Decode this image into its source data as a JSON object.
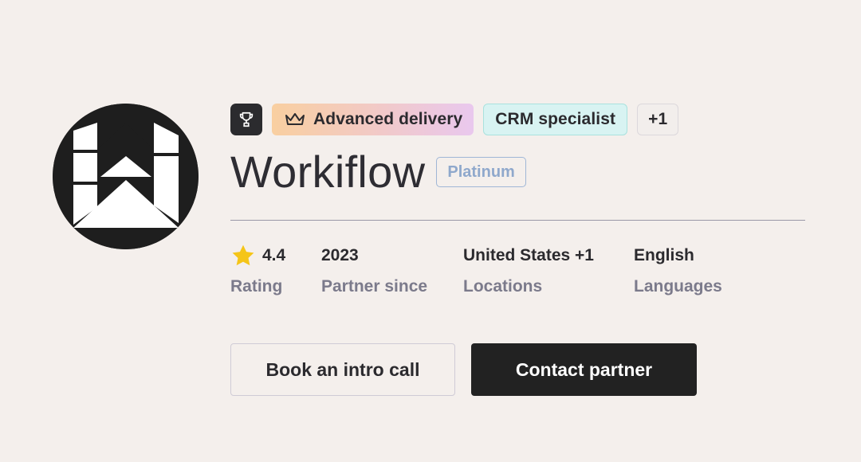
{
  "partner": {
    "logo_icon": "workiflow-logo",
    "name": "Workiflow",
    "tier": "Platinum"
  },
  "badges": {
    "award_icon": "trophy-icon",
    "advanced": {
      "icon": "crown-icon",
      "label": "Advanced delivery"
    },
    "crm": "CRM specialist",
    "more": "+1"
  },
  "stats": {
    "rating": {
      "value": "4.4",
      "label": "Rating",
      "icon": "star-icon"
    },
    "partner_since": {
      "value": "2023",
      "label": "Partner since"
    },
    "locations": {
      "value": "United States +1",
      "label": "Locations"
    },
    "languages": {
      "value": "English",
      "label": "Languages"
    }
  },
  "actions": {
    "intro_call": "Book an intro call",
    "contact": "Contact partner"
  },
  "colors": {
    "background": "#f4efec",
    "primary_button": "#222222",
    "star": "#f5c518",
    "tier": "#8fa8cc",
    "crm_bg": "#d8f3f2"
  }
}
